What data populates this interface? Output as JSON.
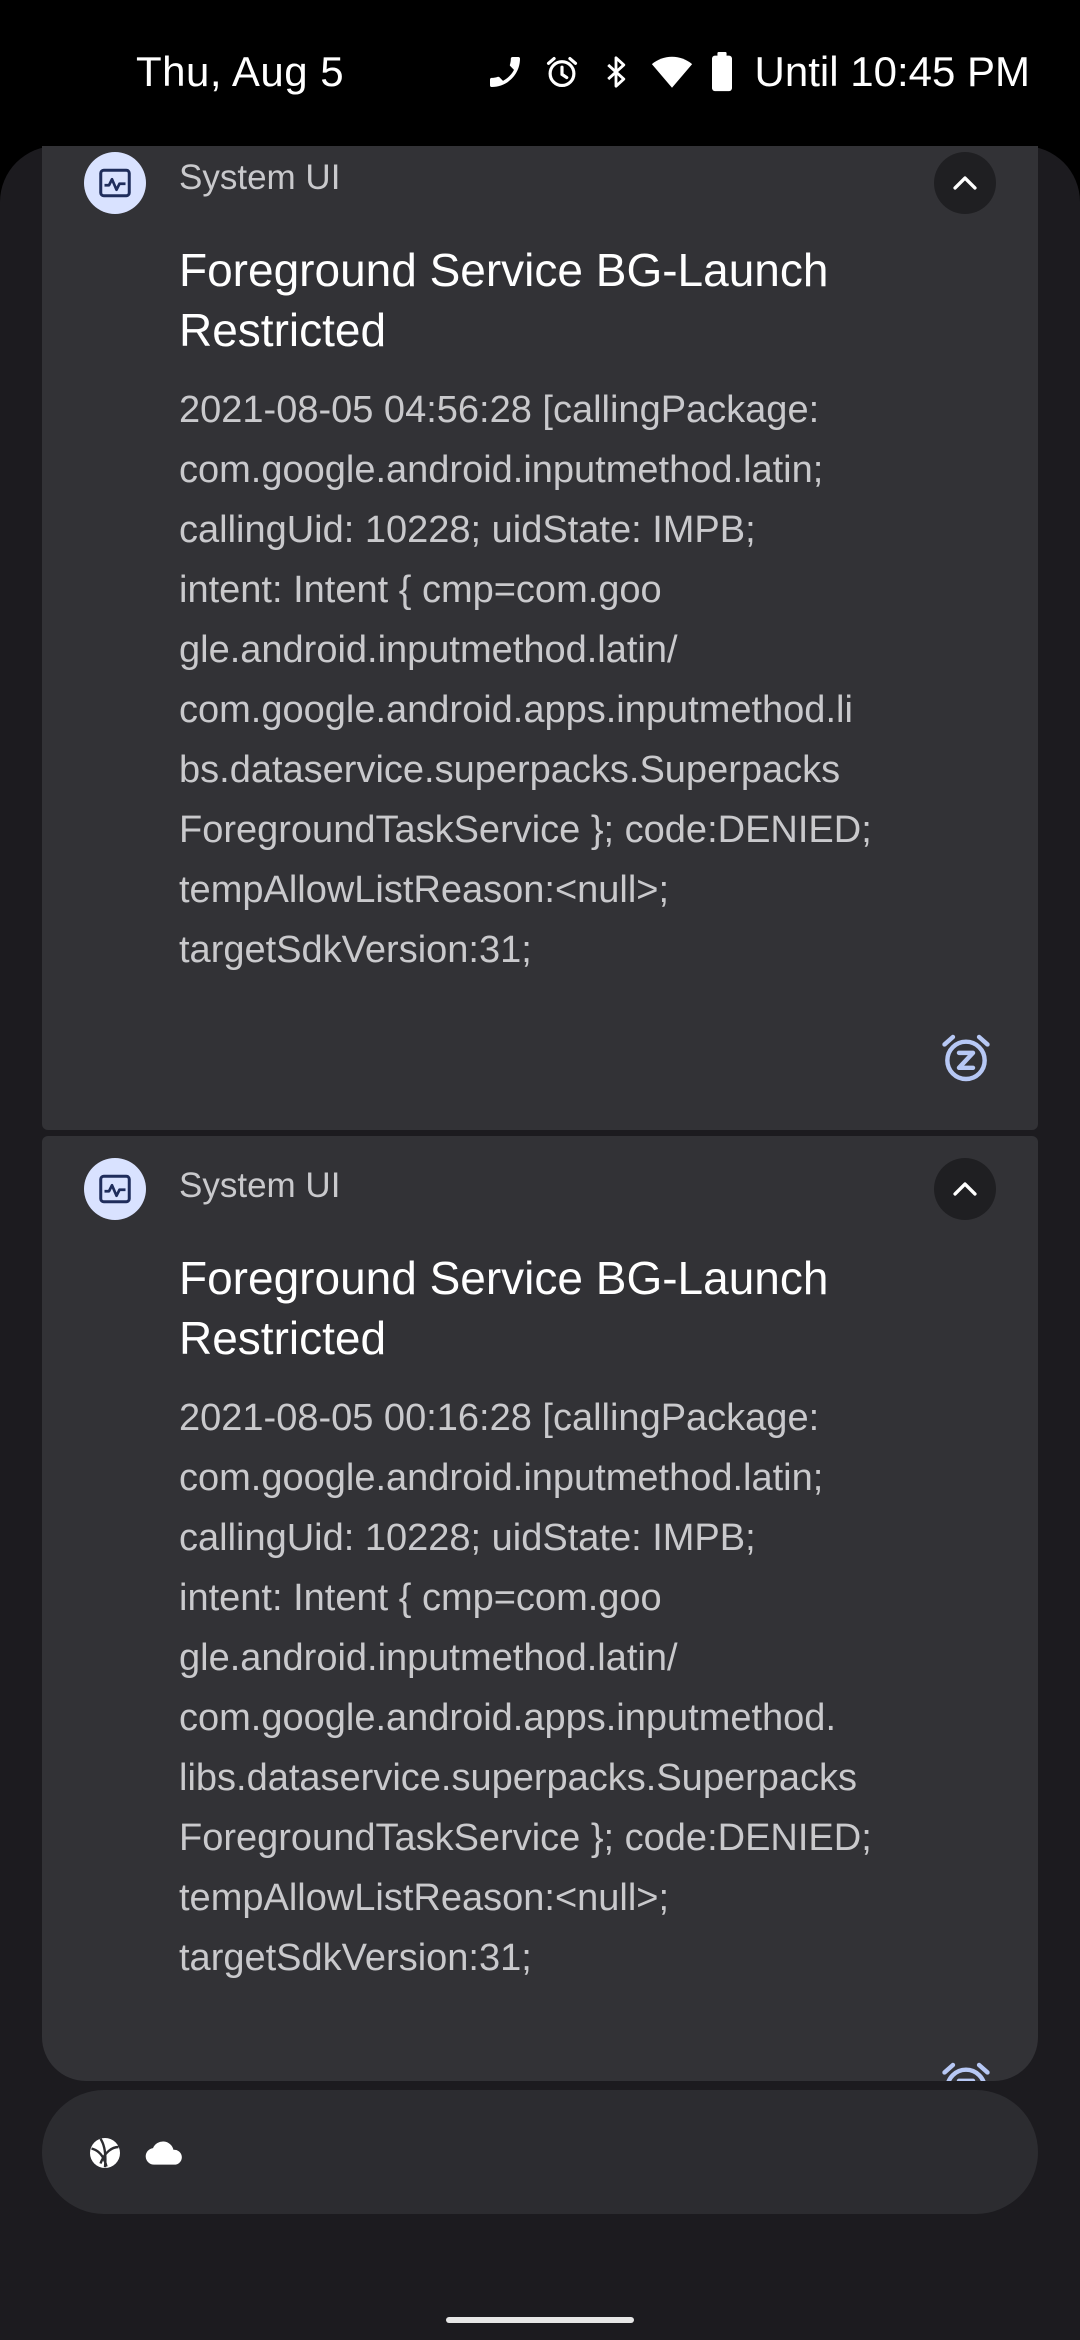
{
  "status_bar": {
    "date": "Thu, Aug 5",
    "battery_text": "Until 10:45 PM",
    "icons": [
      "wifi-calling-icon",
      "alarm-icon",
      "bluetooth-icon",
      "wifi-icon",
      "battery-icon"
    ]
  },
  "notifications": [
    {
      "app_name": "System UI",
      "app_icon": "system-ui-icon",
      "title": "Foreground Service BG-Launch Restricted",
      "text_lines": [
        "2021-08-05 04:56:28 [callingPackage:",
        "com.google.android.inputmethod.latin;",
        "callingUid: 10228; uidState: IMPB;",
        "intent: Intent { cmp=com.goo",
        "gle.android.inputmethod.latin/",
        "com.google.android.apps.inputmethod.li",
        "bs.dataservice.superpacks.Superpacks",
        "ForegroundTaskService }; code:DENIED;",
        "tempAllowListReason:<null>;",
        "targetSdkVersion:31;"
      ],
      "expand_icon": "chevron-up-icon",
      "snooze_icon": "snooze-icon"
    },
    {
      "app_name": "System UI",
      "app_icon": "system-ui-icon",
      "title": "Foreground Service BG-Launch Restricted",
      "text_lines": [
        "2021-08-05 00:16:28 [callingPackage:",
        "com.google.android.inputmethod.latin;",
        "callingUid: 10228; uidState: IMPB;",
        "intent: Intent { cmp=com.goo",
        "gle.android.inputmethod.latin/",
        "com.google.android.apps.inputmethod.",
        "libs.dataservice.superpacks.Superpacks",
        "ForegroundTaskService }; code:DENIED;",
        "tempAllowListReason:<null>;",
        "targetSdkVersion:31;"
      ],
      "expand_icon": "chevron-up-icon",
      "snooze_icon": "snooze-icon"
    }
  ],
  "shelf": {
    "icons": [
      "sports-ball-icon",
      "cloud-icon"
    ]
  },
  "colors": {
    "background": "#000000",
    "shade": "#1c1b1f",
    "card": "#323236",
    "app_icon_bg": "#d9e2ff",
    "accent": "#b7c8f5"
  }
}
